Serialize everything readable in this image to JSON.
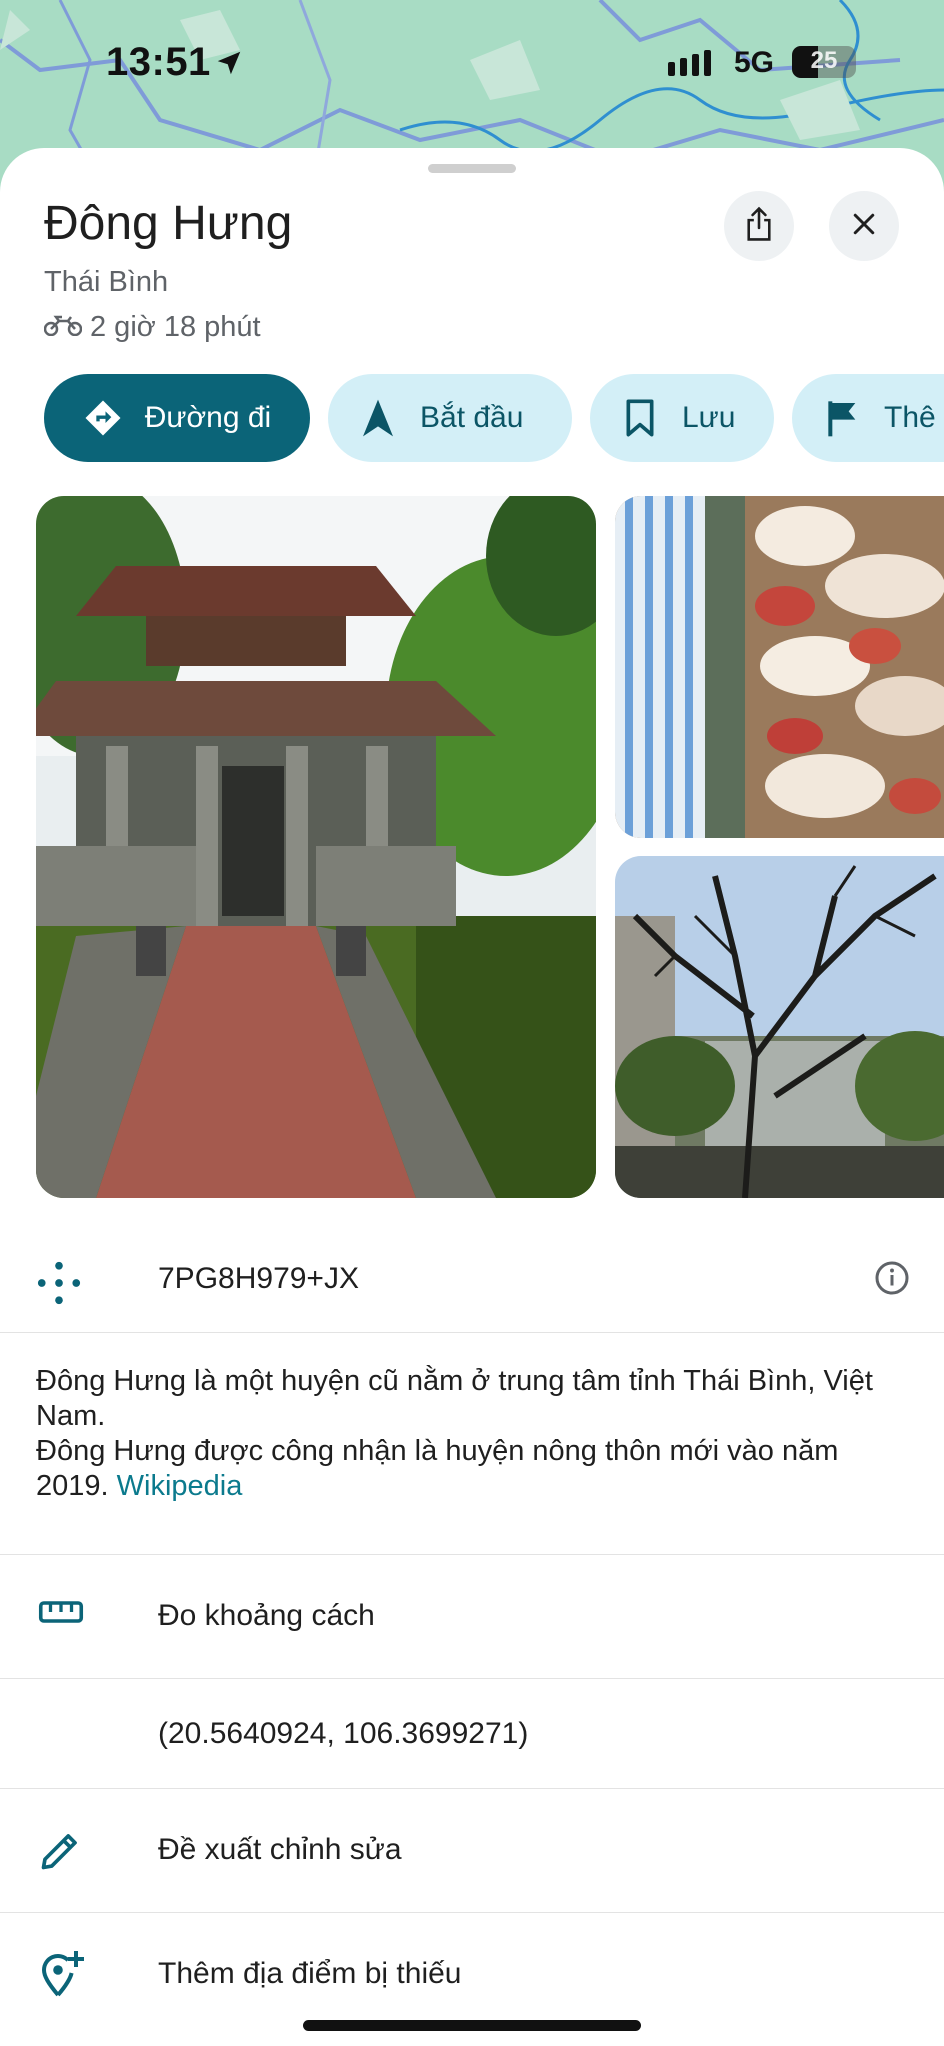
{
  "status_bar": {
    "time": "13:51",
    "network": "5G",
    "battery": "25"
  },
  "place": {
    "name": "Đông Hưng",
    "region": "Thái Bình",
    "travel_time": "2 giờ 18 phút"
  },
  "actions": [
    {
      "label": "Đường đi",
      "icon": "directions-icon"
    },
    {
      "label": "Bắt đầu",
      "icon": "navigation-arrow-icon"
    },
    {
      "label": "Lưu",
      "icon": "bookmark-icon"
    },
    {
      "label": "Thê",
      "icon": "flag-icon"
    }
  ],
  "photos": [
    {
      "description_icon": "pagoda-photo"
    },
    {
      "description_icon": "festival-photo"
    },
    {
      "description_icon": "village-tree-photo"
    }
  ],
  "plus_code": "7PG8H979+JX",
  "description": {
    "line1": "Đông Hưng là một huyện cũ nằm ở trung tâm tỉnh Thái Bình, Việt Nam.",
    "line2": "Đông Hưng được công nhận là huyện nông thôn mới vào năm 2019.",
    "source_link": "Wikipedia"
  },
  "menu": {
    "measure_distance": "Đo khoảng cách",
    "coordinates": "(20.5640924, 106.3699271)",
    "suggest_edit": "Đề xuất chỉnh sửa",
    "add_missing_place": "Thêm địa điểm bị thiếu"
  },
  "colors": {
    "accent": "#0b6478",
    "chip_bg": "#d3eff7",
    "link": "#0b7a8d"
  }
}
